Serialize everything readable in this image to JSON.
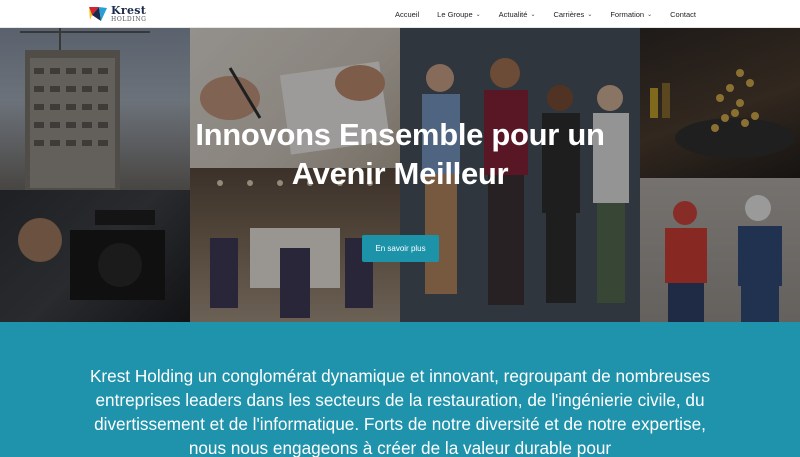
{
  "brand": {
    "name": "Krest",
    "sub": "HOLDING",
    "colors": {
      "red": "#d4242f",
      "navy": "#1b2a4a",
      "teal": "#1f93ab"
    }
  },
  "nav": {
    "items": [
      {
        "label": "Accueil",
        "has_dropdown": false
      },
      {
        "label": "Le Groupe",
        "has_dropdown": true
      },
      {
        "label": "Actualité",
        "has_dropdown": true
      },
      {
        "label": "Carrières",
        "has_dropdown": true
      },
      {
        "label": "Formation",
        "has_dropdown": true
      },
      {
        "label": "Contact",
        "has_dropdown": false
      }
    ]
  },
  "hero": {
    "title_line1": "Innovons Ensemble pour un",
    "title_line2": "Avenir Meilleur",
    "cta_label": "En savoir plus",
    "cta_color": "#1d93a9"
  },
  "about": {
    "text": "Krest Holding un conglomérat dynamique et innovant, regroupant de nombreuses entreprises leaders dans les secteurs de la restauration, de l'ingénierie civile, du divertissement et de l'informatique. Forts de notre diversité et de notre expertise, nous nous engageons à créer de la valeur durable pour"
  }
}
